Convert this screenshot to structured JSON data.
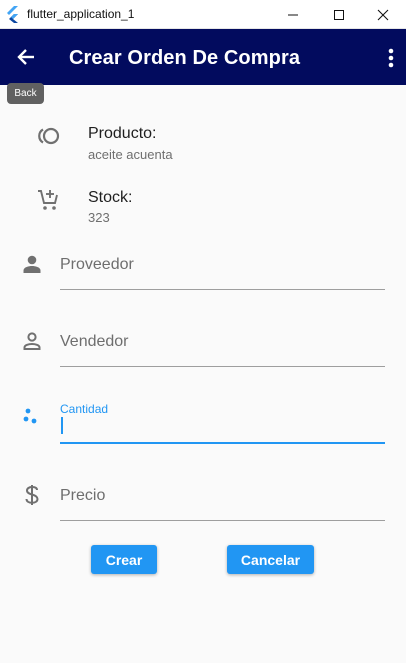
{
  "window": {
    "title": "flutter_application_1"
  },
  "appbar": {
    "title": "Crear Orden De Compra",
    "back_tooltip": "Back",
    "color": "#020b5e"
  },
  "product": {
    "label": "Producto:",
    "value": "aceite acuenta"
  },
  "stock": {
    "label": "Stock:",
    "value": "323"
  },
  "form": {
    "proveedor_label": "Proveedor",
    "vendedor_label": "Vendedor",
    "cantidad_label": "Cantidad",
    "cantidad_value": "",
    "precio_label": "Precio"
  },
  "buttons": {
    "crear": "Crear",
    "cancelar": "Cancelar",
    "color": "#2196f3"
  },
  "icons": {
    "back": "arrow-left-icon",
    "menu": "more-vertical-icon",
    "product": "toll-icon",
    "stock": "add-shopping-cart-icon",
    "proveedor": "person-icon",
    "vendedor": "person-outline-icon",
    "cantidad": "dots-icon",
    "precio": "dollar-icon"
  }
}
